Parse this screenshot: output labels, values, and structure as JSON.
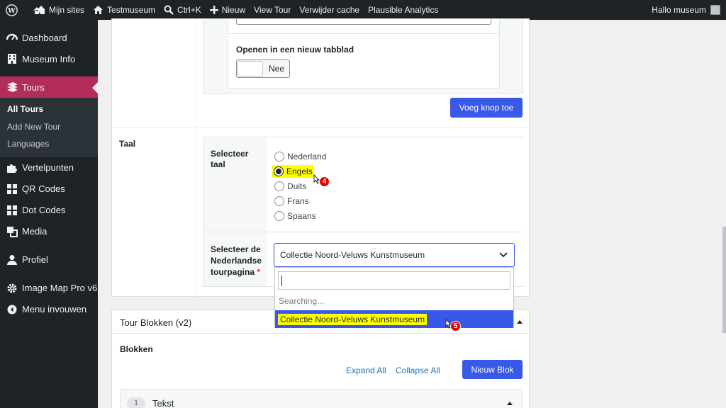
{
  "adminbar": {
    "my_sites": "Mijn sites",
    "site_name": "Testmuseum",
    "shortcut": "Ctrl+K",
    "new": "Nieuw",
    "view_tour": "View Tour",
    "clear_cache": "Verwijder cache",
    "analytics": "Plausible Analytics",
    "greeting": "Hallo museum"
  },
  "sidebar": {
    "items": [
      {
        "label": "Dashboard",
        "icon": "dashboard-icon"
      },
      {
        "label": "Museum Info",
        "icon": "building-icon"
      },
      {
        "label": "Tours",
        "icon": "tours-icon"
      },
      {
        "label": "Vertelpunten",
        "icon": "puzzle-icon"
      },
      {
        "label": "QR Codes",
        "icon": "grid-icon"
      },
      {
        "label": "Dot Codes",
        "icon": "grid-icon"
      },
      {
        "label": "Media",
        "icon": "media-icon"
      },
      {
        "label": "Profiel",
        "icon": "user-icon"
      },
      {
        "label": "Image Map Pro v6",
        "icon": "gear-icon"
      },
      {
        "label": "Menu invouwen",
        "icon": "collapse-icon"
      }
    ],
    "submenu": [
      "All Tours",
      "Add New Tour",
      "Languages"
    ]
  },
  "form": {
    "new_tab_label": "Openen in een nieuw tabblad",
    "toggle_value": "Nee",
    "add_button": "Voeg knop toe",
    "language_section": "Taal",
    "select_language_label": "Selecteer taal",
    "languages": [
      "Nederland",
      "Engels",
      "Duits",
      "Frans",
      "Spaans"
    ],
    "selected_language": "Engels",
    "tour_page_label_line1": "Selecteer de",
    "tour_page_label_line2": "Nederlandse",
    "tour_page_label_line3": "tourpagina",
    "required_mark": "*",
    "select_value": "Collectie Noord-Veluws Kunstmuseum",
    "search_status": "Searching...",
    "option_highlighted": "Collectie Noord-Veluws Kunstmuseum"
  },
  "annotations": {
    "step4": "4",
    "step5": "5"
  },
  "blocks": {
    "title": "Tour Blokken (v2)",
    "subtitle": "Blokken",
    "expand_all": "Expand All",
    "collapse_all": "Collapse All",
    "new_block": "Nieuw Blok",
    "first_block_number": "1",
    "first_block_label": "Tekst"
  },
  "colors": {
    "accent": "#3858e9",
    "active_menu": "#b32d5b",
    "highlight": "#ffff00",
    "badge": "#e00000"
  }
}
